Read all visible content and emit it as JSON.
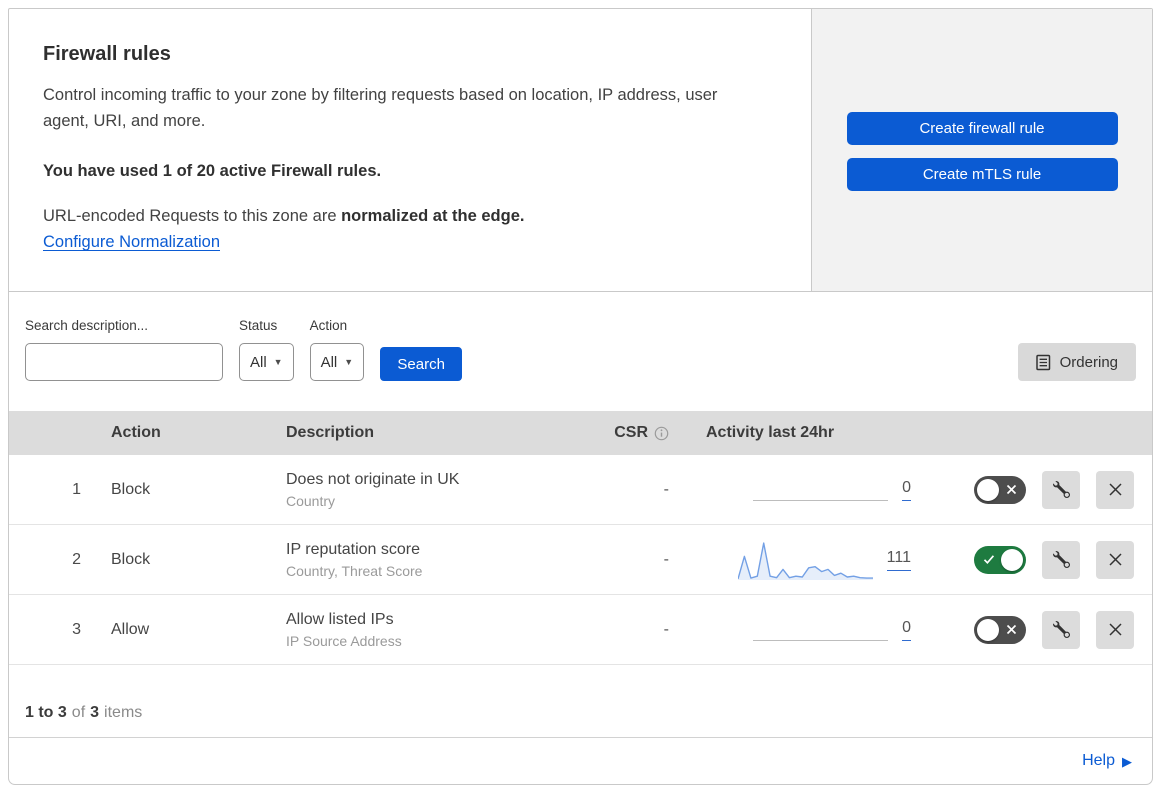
{
  "header": {
    "title": "Firewall rules",
    "description": "Control incoming traffic to your zone by filtering requests based on location, IP address, user agent, URI, and more.",
    "usage_bold": "You have used 1 of 20 active Firewall rules.",
    "normalization_text": "URL-encoded Requests to this zone are ",
    "normalization_bold": "normalized at the edge.",
    "normalization_link": "Configure Normalization",
    "buttons": {
      "create_firewall": "Create firewall rule",
      "create_mtls": "Create mTLS rule"
    }
  },
  "filters": {
    "search_label": "Search description...",
    "status_label": "Status",
    "status_value": "All",
    "action_label": "Action",
    "action_value": "All",
    "search_button": "Search",
    "ordering_button": "Ordering"
  },
  "table": {
    "columns": {
      "action": "Action",
      "description": "Description",
      "csr": "CSR",
      "activity": "Activity last 24hr"
    },
    "rows": [
      {
        "priority": "1",
        "action": "Block",
        "description": "Does not originate in UK",
        "fields": "Country",
        "csr": "-",
        "activity_count": "0",
        "state": "off",
        "sparkline": []
      },
      {
        "priority": "2",
        "action": "Block",
        "description": "IP reputation score",
        "fields": "Country, Threat Score",
        "csr": "-",
        "activity_count": "111",
        "state": "on",
        "sparkline": [
          0.03,
          0.62,
          0.05,
          0.1,
          0.97,
          0.1,
          0.06,
          0.28,
          0.06,
          0.1,
          0.08,
          0.32,
          0.35,
          0.22,
          0.28,
          0.12,
          0.18,
          0.08,
          0.1,
          0.06,
          0.05,
          0.05
        ]
      },
      {
        "priority": "3",
        "action": "Allow",
        "description": "Allow listed IPs",
        "fields": "IP Source Address",
        "csr": "-",
        "activity_count": "0",
        "state": "off",
        "sparkline": []
      }
    ]
  },
  "footer": {
    "range_bold": "1 to 3",
    "of_label": "of",
    "total_bold": "3",
    "items_label": "items",
    "help": "Help"
  },
  "colors": {
    "accent_blue": "#0b5bd3",
    "toggle_on_green": "#1e7b40",
    "toggle_off_gray": "#4d4d4d",
    "sparkline_blue": "#73a0e5",
    "table_header_gray": "#dcdcdc",
    "panel_gray": "#f2f2f2"
  }
}
